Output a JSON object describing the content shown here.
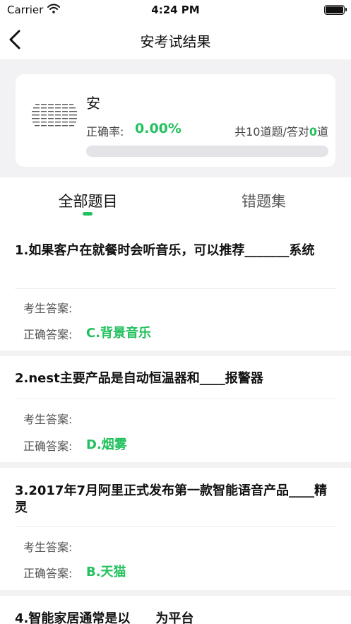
{
  "status_bar": {
    "carrier": "Carrier",
    "time": "4:24 PM"
  },
  "nav": {
    "title": "安考试结果"
  },
  "summary": {
    "name": "安",
    "rate_label": "正确率:",
    "rate_value": "0.00%",
    "score_prefix": "共10道题/答对",
    "score_correct": "0",
    "score_suffix": "道",
    "progress": 0
  },
  "tabs": [
    {
      "label": "全部题目"
    },
    {
      "label": "错题集"
    }
  ],
  "colors": {
    "accent": "#22c15e",
    "background": "#f2f2f4",
    "card": "#ffffff"
  },
  "questions": [
    {
      "title": "1.如果客户在就餐时会听音乐，可以推荐_______系统",
      "examinee_label": "考生答案:",
      "examinee_answer": "",
      "correct_label": "正确答案:",
      "correct_answer": "C.背景音乐"
    },
    {
      "title": "2.nest主要产品是自动恒温器和____报警器",
      "examinee_label": "考生答案:",
      "examinee_answer": "",
      "correct_label": "正确答案:",
      "correct_answer": "D.烟雾"
    },
    {
      "title": "3.2017年7月阿里正式发布第一款智能语音产品____精灵",
      "examinee_label": "考生答案:",
      "examinee_answer": "",
      "correct_label": "正确答案:",
      "correct_answer": "B.天猫"
    },
    {
      "title": "4.智能家居通常是以____为平台"
    }
  ]
}
